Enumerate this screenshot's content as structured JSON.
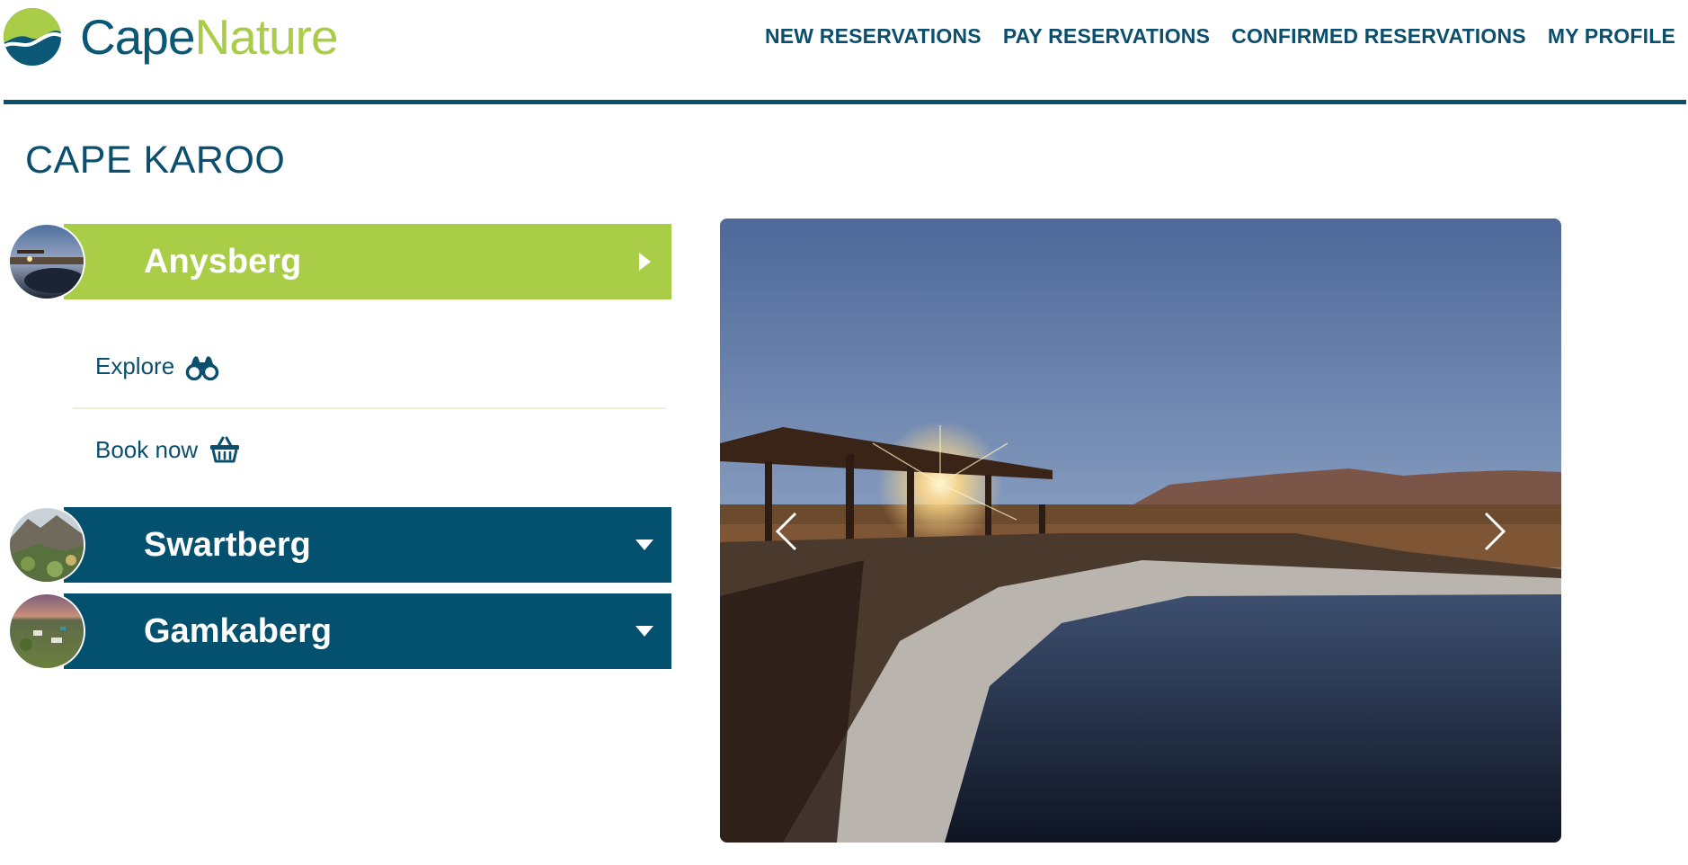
{
  "brand": {
    "name_part1": "Cape",
    "name_part2": "Nature",
    "primary": "#0b4f6e",
    "accent": "#a9cd47"
  },
  "nav": {
    "items": [
      {
        "label": "NEW RESERVATIONS"
      },
      {
        "label": "PAY RESERVATIONS"
      },
      {
        "label": "CONFIRMED RESERVATIONS"
      },
      {
        "label": "MY PROFILE"
      }
    ]
  },
  "page": {
    "title": "CAPE KAROO"
  },
  "reserves": [
    {
      "name": "Anysberg",
      "state": "expanded",
      "caret_icon": "caret-right-icon",
      "actions": [
        {
          "label": "Explore",
          "icon": "binoculars-icon"
        },
        {
          "label": "Book now",
          "icon": "basket-icon"
        }
      ]
    },
    {
      "name": "Swartberg",
      "state": "collapsed",
      "caret_icon": "caret-down-icon"
    },
    {
      "name": "Gamkaberg",
      "state": "collapsed",
      "caret_icon": "caret-down-icon"
    }
  ],
  "carousel": {
    "prev_icon": "chevron-left-icon",
    "next_icon": "chevron-right-icon"
  }
}
